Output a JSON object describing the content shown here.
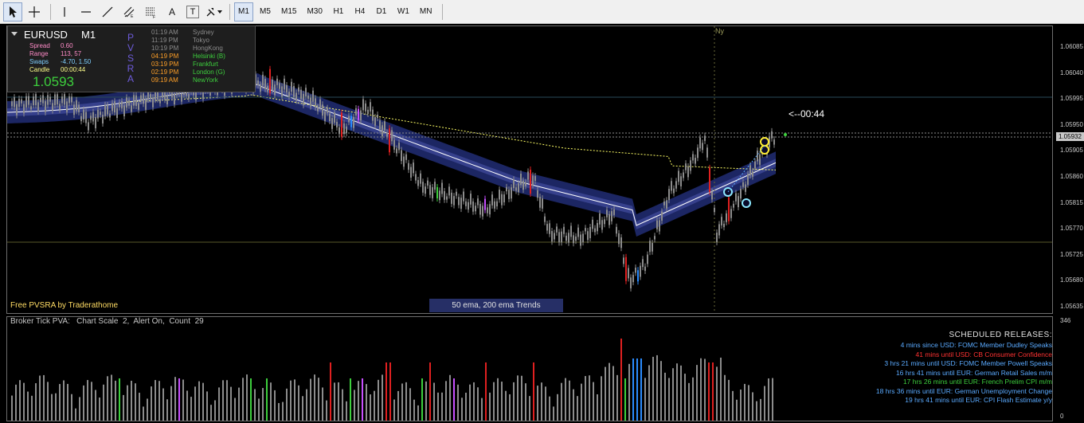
{
  "toolbar": {
    "tools": [
      {
        "name": "cursor-tool",
        "icon": "cursor-icon",
        "active": true
      },
      {
        "name": "crosshair-tool",
        "icon": "crosshair-icon"
      },
      {
        "name": "vertical-line-tool",
        "icon": "vertical-line-icon"
      },
      {
        "name": "horizontal-line-tool",
        "icon": "horizontal-line-icon"
      },
      {
        "name": "trendline-tool",
        "icon": "trendline-icon"
      },
      {
        "name": "equidistant-channel-tool",
        "icon": "channel-icon"
      },
      {
        "name": "fibonacci-tool",
        "icon": "fibonacci-icon"
      },
      {
        "name": "text-tool",
        "icon": "text-icon",
        "label": "A"
      },
      {
        "name": "text-label-tool",
        "icon": "text-label-icon",
        "label": "T"
      },
      {
        "name": "arrows-tool",
        "icon": "arrows-icon"
      }
    ],
    "timeframes": [
      "M1",
      "M5",
      "M15",
      "M30",
      "H1",
      "H4",
      "D1",
      "W1",
      "MN"
    ],
    "active_timeframe": "M1"
  },
  "info": {
    "symbol": "EURUSD",
    "timeframe": "M1",
    "rows": [
      {
        "key": "Spread",
        "value": "0.60",
        "color": "pink"
      },
      {
        "key": "Range",
        "value": "113, 57",
        "color": "pink"
      },
      {
        "key": "Swaps",
        "value": "-4.70, 1.50",
        "color": "blue"
      },
      {
        "key": "Candle",
        "value": "00:00:44",
        "color": "yel"
      }
    ],
    "price": "1.0593",
    "pvsra": [
      "P",
      "V",
      "S",
      "R",
      "A"
    ],
    "sessions": [
      {
        "time": "01:19 AM",
        "name": "Sydney",
        "color": "#8c8c8c"
      },
      {
        "time": "11:19 PM",
        "name": "Tokyo",
        "color": "#8c8c8c"
      },
      {
        "time": "10:19 PM",
        "name": "HongKong",
        "color": "#8c8c8c"
      },
      {
        "time": "04:19 PM",
        "name": "Helsinki  (B)",
        "time_color": "#ffa028",
        "color": "#3dcf3d"
      },
      {
        "time": "03:19 PM",
        "name": "Frankfurt",
        "time_color": "#ffa028",
        "color": "#3dcf3d"
      },
      {
        "time": "02:19 PM",
        "name": "London  (G)",
        "time_color": "#ffa028",
        "color": "#3dcf3d"
      },
      {
        "time": "09:19 AM",
        "name": "NewYork",
        "time_color": "#ffa028",
        "color": "#3dcf3d"
      }
    ]
  },
  "main": {
    "free_label": "Free PVSRA by Traderathome",
    "trend_label": "50 ema, 200 ema Trends",
    "timer": "<--00:44",
    "ny_label": "Ny",
    "price_axis": [
      "1.06085",
      "1.06040",
      "1.05995",
      "1.05950",
      "1.05905",
      "1.05860",
      "1.05815",
      "1.05770",
      "1.05725",
      "1.05680",
      "1.05635"
    ],
    "current_price": "1.05932"
  },
  "indicator": {
    "title": "Broker Tick PVA:   Chart Scale  2,  Alert On,  Count  29",
    "scale_top": "346",
    "scale_bottom": "0"
  },
  "schedule": {
    "title": "SCHEDULED RELEASES:",
    "items": [
      {
        "text": "4 mins since USD: FOMC Member Dudley Speaks",
        "color": "#5aaaff"
      },
      {
        "text": "41 mins until USD: CB Consumer Confidence",
        "color": "#ff3232"
      },
      {
        "text": "3 hrs 21 mins until USD: FOMC Member Powell Speaks",
        "color": "#5aaaff"
      },
      {
        "text": "16 hrs 41 mins until EUR: German Retail Sales m/m",
        "color": "#5aaaff"
      },
      {
        "text": "17 hrs 26 mins until EUR: French Prelim CPI m/m",
        "color": "#3dcf3d"
      },
      {
        "text": "18 hrs 36 mins until EUR: German Unemployment Change",
        "color": "#5aaaff"
      },
      {
        "text": "19 hrs 41 mins until EUR: CPI Flash Estimate y/y",
        "color": "#5aaaff"
      }
    ]
  },
  "colors": {
    "band": "#1f2a6e",
    "ema": "#ffffff",
    "ema200": "#ffff66",
    "bull": "#8c8c8c",
    "climax_bear": "#e02020",
    "climax_bull": "#3dcf3d",
    "rising_bull": "#2a8cff",
    "rising_bear": "#c850ff"
  }
}
